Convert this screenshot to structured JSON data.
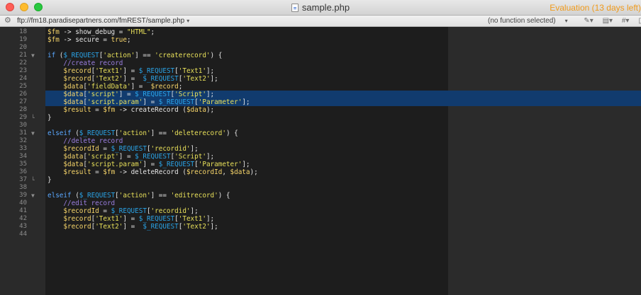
{
  "window": {
    "title": "sample.php",
    "evaluation_text": "Evaluation (13 days left)"
  },
  "navbar": {
    "path": "ftp://fm18.paradisepartners.com/fmREST/sample.php",
    "function_selector": "(no function selected)",
    "icons": [
      "gear-icon",
      "bookmark-icon",
      "clipboard-icon",
      "hash-icon",
      "document-icon"
    ]
  },
  "editor": {
    "lines": [
      {
        "n": "18",
        "fold": "",
        "sel": false,
        "tokens": [
          [
            "var",
            "$fm"
          ],
          [
            "op",
            " -> "
          ],
          [
            "plain",
            "show_debug = "
          ],
          [
            "str",
            "\"HTML\""
          ],
          [
            "plain",
            ";"
          ]
        ]
      },
      {
        "n": "19",
        "fold": "",
        "sel": false,
        "tokens": [
          [
            "var",
            "$fm"
          ],
          [
            "op",
            " -> "
          ],
          [
            "plain",
            "secure = "
          ],
          [
            "const",
            "true"
          ],
          [
            "plain",
            ";"
          ]
        ]
      },
      {
        "n": "20",
        "fold": "",
        "sel": false,
        "tokens": []
      },
      {
        "n": "21",
        "fold": "▼",
        "sel": false,
        "tokens": [
          [
            "kw",
            "if"
          ],
          [
            "plain",
            " ("
          ],
          [
            "sup",
            "$_REQUEST"
          ],
          [
            "plain",
            "["
          ],
          [
            "str",
            "'action'"
          ],
          [
            "plain",
            "] == "
          ],
          [
            "str",
            "'createrecord'"
          ],
          [
            "plain",
            ") {"
          ]
        ]
      },
      {
        "n": "22",
        "fold": "",
        "sel": false,
        "tokens": [
          [
            "plain",
            "    "
          ],
          [
            "com",
            "//create record"
          ]
        ]
      },
      {
        "n": "23",
        "fold": "",
        "sel": false,
        "tokens": [
          [
            "plain",
            "    "
          ],
          [
            "var",
            "$record"
          ],
          [
            "plain",
            "["
          ],
          [
            "str",
            "'Text1'"
          ],
          [
            "plain",
            "] = "
          ],
          [
            "sup",
            "$_REQUEST"
          ],
          [
            "plain",
            "["
          ],
          [
            "str",
            "'Text1'"
          ],
          [
            "plain",
            "];"
          ]
        ]
      },
      {
        "n": "24",
        "fold": "",
        "sel": false,
        "tokens": [
          [
            "plain",
            "    "
          ],
          [
            "var",
            "$record"
          ],
          [
            "plain",
            "["
          ],
          [
            "str",
            "'Text2'"
          ],
          [
            "plain",
            "] =  "
          ],
          [
            "sup",
            "$_REQUEST"
          ],
          [
            "plain",
            "["
          ],
          [
            "str",
            "'Text2'"
          ],
          [
            "plain",
            "];"
          ]
        ]
      },
      {
        "n": "25",
        "fold": "",
        "sel": false,
        "tokens": [
          [
            "plain",
            "    "
          ],
          [
            "var",
            "$data"
          ],
          [
            "plain",
            "["
          ],
          [
            "str",
            "'fieldData'"
          ],
          [
            "plain",
            "] =  "
          ],
          [
            "var",
            "$record"
          ],
          [
            "plain",
            ";"
          ]
        ]
      },
      {
        "n": "26",
        "fold": "",
        "sel": true,
        "tokens": [
          [
            "plain",
            "    "
          ],
          [
            "var",
            "$data"
          ],
          [
            "plain",
            "["
          ],
          [
            "str",
            "'script'"
          ],
          [
            "plain",
            "] = "
          ],
          [
            "sup",
            "$_REQUEST"
          ],
          [
            "plain",
            "["
          ],
          [
            "str",
            "'Script'"
          ],
          [
            "plain",
            "];"
          ]
        ]
      },
      {
        "n": "27",
        "fold": "",
        "sel": true,
        "tokens": [
          [
            "plain",
            "    "
          ],
          [
            "var",
            "$data"
          ],
          [
            "plain",
            "["
          ],
          [
            "str",
            "'script.param'"
          ],
          [
            "plain",
            "] = "
          ],
          [
            "sup",
            "$_REQUEST"
          ],
          [
            "plain",
            "["
          ],
          [
            "str",
            "'Parameter'"
          ],
          [
            "plain",
            "];"
          ]
        ]
      },
      {
        "n": "28",
        "fold": "",
        "sel": false,
        "tokens": [
          [
            "plain",
            "    "
          ],
          [
            "var",
            "$result"
          ],
          [
            "plain",
            " = "
          ],
          [
            "var",
            "$fm"
          ],
          [
            "op",
            " -> "
          ],
          [
            "plain",
            "createRecord ("
          ],
          [
            "var",
            "$data"
          ],
          [
            "plain",
            ");"
          ]
        ]
      },
      {
        "n": "29",
        "fold": "└",
        "sel": false,
        "tokens": [
          [
            "plain",
            "}"
          ]
        ]
      },
      {
        "n": "30",
        "fold": "",
        "sel": false,
        "tokens": []
      },
      {
        "n": "31",
        "fold": "▼",
        "sel": false,
        "tokens": [
          [
            "kw",
            "elseif"
          ],
          [
            "plain",
            " ("
          ],
          [
            "sup",
            "$_REQUEST"
          ],
          [
            "plain",
            "["
          ],
          [
            "str",
            "'action'"
          ],
          [
            "plain",
            "] == "
          ],
          [
            "str",
            "'deleterecord'"
          ],
          [
            "plain",
            ") {"
          ]
        ]
      },
      {
        "n": "32",
        "fold": "",
        "sel": false,
        "tokens": [
          [
            "plain",
            "    "
          ],
          [
            "com",
            "//delete record"
          ]
        ]
      },
      {
        "n": "33",
        "fold": "",
        "sel": false,
        "tokens": [
          [
            "plain",
            "    "
          ],
          [
            "var",
            "$recordId"
          ],
          [
            "plain",
            " = "
          ],
          [
            "sup",
            "$_REQUEST"
          ],
          [
            "plain",
            "["
          ],
          [
            "str",
            "'recordid'"
          ],
          [
            "plain",
            "];"
          ]
        ]
      },
      {
        "n": "34",
        "fold": "",
        "sel": false,
        "tokens": [
          [
            "plain",
            "    "
          ],
          [
            "var",
            "$data"
          ],
          [
            "plain",
            "["
          ],
          [
            "str",
            "'script'"
          ],
          [
            "plain",
            "] = "
          ],
          [
            "sup",
            "$_REQUEST"
          ],
          [
            "plain",
            "["
          ],
          [
            "str",
            "'Script'"
          ],
          [
            "plain",
            "];"
          ]
        ]
      },
      {
        "n": "35",
        "fold": "",
        "sel": false,
        "tokens": [
          [
            "plain",
            "    "
          ],
          [
            "var",
            "$data"
          ],
          [
            "plain",
            "["
          ],
          [
            "str",
            "'script.param'"
          ],
          [
            "plain",
            "] = "
          ],
          [
            "sup",
            "$_REQUEST"
          ],
          [
            "plain",
            "["
          ],
          [
            "str",
            "'Parameter'"
          ],
          [
            "plain",
            "];"
          ]
        ]
      },
      {
        "n": "36",
        "fold": "",
        "sel": false,
        "tokens": [
          [
            "plain",
            "    "
          ],
          [
            "var",
            "$result"
          ],
          [
            "plain",
            " = "
          ],
          [
            "var",
            "$fm"
          ],
          [
            "op",
            " -> "
          ],
          [
            "plain",
            "deleteRecord ("
          ],
          [
            "var",
            "$recordId"
          ],
          [
            "plain",
            ", "
          ],
          [
            "var",
            "$data"
          ],
          [
            "plain",
            ");"
          ]
        ]
      },
      {
        "n": "37",
        "fold": "└",
        "sel": false,
        "tokens": [
          [
            "plain",
            "}"
          ]
        ]
      },
      {
        "n": "38",
        "fold": "",
        "sel": false,
        "tokens": []
      },
      {
        "n": "39",
        "fold": "▼",
        "sel": false,
        "tokens": [
          [
            "kw",
            "elseif"
          ],
          [
            "plain",
            " ("
          ],
          [
            "sup",
            "$_REQUEST"
          ],
          [
            "plain",
            "["
          ],
          [
            "str",
            "'action'"
          ],
          [
            "plain",
            "] == "
          ],
          [
            "str",
            "'editrecord'"
          ],
          [
            "plain",
            ") {"
          ]
        ]
      },
      {
        "n": "40",
        "fold": "",
        "sel": false,
        "tokens": [
          [
            "plain",
            "    "
          ],
          [
            "com",
            "//edit record"
          ]
        ]
      },
      {
        "n": "41",
        "fold": "",
        "sel": false,
        "tokens": [
          [
            "plain",
            "    "
          ],
          [
            "var",
            "$recordId"
          ],
          [
            "plain",
            " = "
          ],
          [
            "sup",
            "$_REQUEST"
          ],
          [
            "plain",
            "["
          ],
          [
            "str",
            "'recordid'"
          ],
          [
            "plain",
            "];"
          ]
        ]
      },
      {
        "n": "42",
        "fold": "",
        "sel": false,
        "tokens": [
          [
            "plain",
            "    "
          ],
          [
            "var",
            "$record"
          ],
          [
            "plain",
            "["
          ],
          [
            "str",
            "'Text1'"
          ],
          [
            "plain",
            "] = "
          ],
          [
            "sup",
            "$_REQUEST"
          ],
          [
            "plain",
            "["
          ],
          [
            "str",
            "'Text1'"
          ],
          [
            "plain",
            "];"
          ]
        ]
      },
      {
        "n": "43",
        "fold": "",
        "sel": false,
        "tokens": [
          [
            "plain",
            "    "
          ],
          [
            "var",
            "$record"
          ],
          [
            "plain",
            "["
          ],
          [
            "str",
            "'Text2'"
          ],
          [
            "plain",
            "] =  "
          ],
          [
            "sup",
            "$_REQUEST"
          ],
          [
            "plain",
            "["
          ],
          [
            "str",
            "'Text2'"
          ],
          [
            "plain",
            "];"
          ]
        ]
      },
      {
        "n": "44",
        "fold": "",
        "sel": false,
        "tokens": []
      }
    ]
  }
}
